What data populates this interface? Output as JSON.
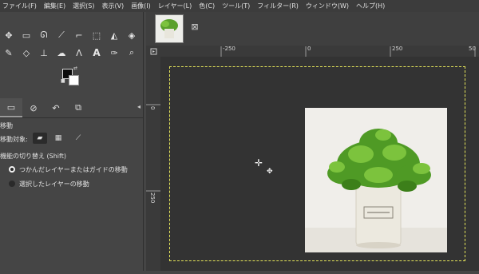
{
  "menubar": {
    "items": [
      "ファイル(F)",
      "編集(E)",
      "選択(S)",
      "表示(V)",
      "画像(I)",
      "レイヤー(L)",
      "色(C)",
      "ツール(T)",
      "フィルター(R)",
      "ウィンドウ(W)",
      "ヘルプ(H)"
    ]
  },
  "tool_options": {
    "title": "移動",
    "move_target_label": "移動対象:",
    "toggle_label": "機能の切り替え  (Shift)",
    "radio_pick_label": "つかんだレイヤーまたはガイドの移動",
    "radio_active_label": "選択したレイヤーの移動"
  },
  "ruler": {
    "h_labels": [
      "-250",
      "0",
      "250",
      "50"
    ],
    "v_labels": [
      "0",
      "250"
    ]
  },
  "icons": {
    "close": "⊠",
    "panel_menu": "◂"
  },
  "colors": {
    "foreground": "#0d0d0d",
    "background": "#ffffff",
    "selection": "#e6e65a"
  }
}
